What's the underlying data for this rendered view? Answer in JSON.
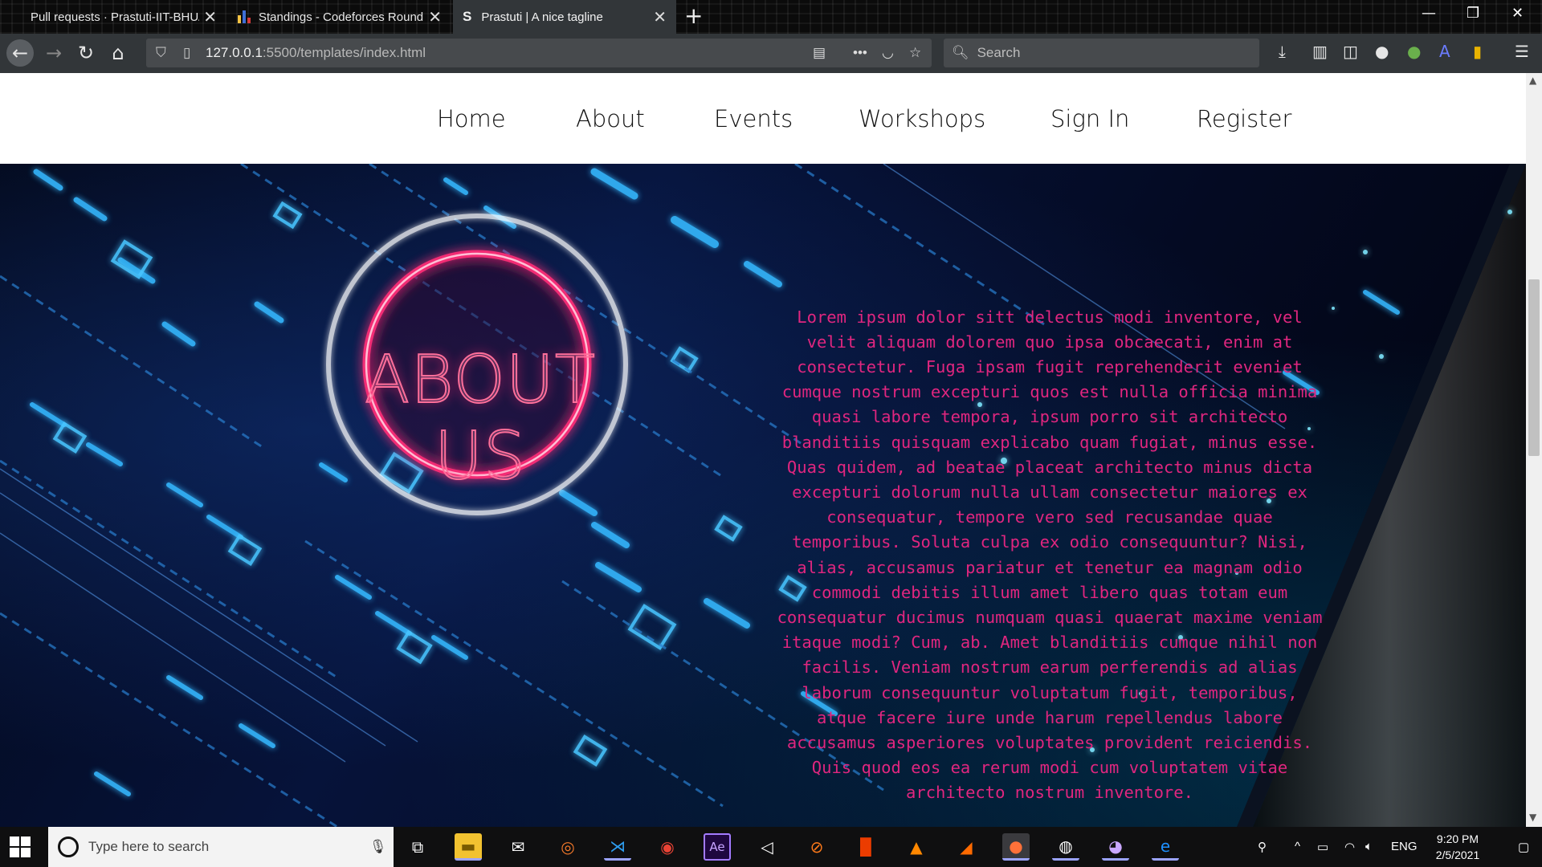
{
  "browser": {
    "tabs": [
      {
        "title": "Pull requests · Prastuti-IIT-BHU/",
        "active": false
      },
      {
        "title": "Standings - Codeforces Round",
        "active": false
      },
      {
        "title": "Prastuti | A nice tagline",
        "active": true
      }
    ],
    "url_host": "127.0.0.1",
    "url_rest": ":5500/templates/index.html",
    "search_placeholder": "Search"
  },
  "site": {
    "nav": [
      "Home",
      "About",
      "Events",
      "Workshops",
      "Sign In",
      "Register"
    ],
    "about_title": "ABOUT US",
    "about_text": "Lorem ipsum dolor sitt delectus modi inventore, vel velit aliquam dolorem quo ipsa obcaecati, enim at consectetur. Fuga ipsam fugit reprehenderit eveniet cumque nostrum excepturi quos est nulla officia minima quasi labore tempora, ipsum porro sit architecto blanditiis quisquam explicabo quam fugiat, minus esse. Quas quidem, ad beatae placeat architecto minus dicta excepturi dolorum nulla ullam consectetur maiores ex consequatur, tempore vero sed recusandae quae temporibus. Soluta culpa ex odio consequuntur? Nisi, alias, accusamus pariatur et tenetur ea magnam odio commodi debitis illum amet libero quas totam eum consequatur ducimus numquam quasi quaerat maxime veniam itaque modi? Cum, ab. Amet blanditiis cumque nihil non facilis. Veniam nostrum earum perferendis ad alias laborum consequuntur voluptatum fugit, temporibus, atque facere iure unde harum repellendus labore accusamus asperiores voluptates provident reiciendis. Quis quod eos ea rerum modi cum voluptatem vitae architecto nostrum inventore."
  },
  "taskbar": {
    "search_placeholder": "Type here to search",
    "language": "ENG",
    "time": "9:20 PM",
    "date": "2/5/2021"
  },
  "colors": {
    "accent_pink": "#e0267f",
    "ring_pink": "#ff6f9a"
  }
}
